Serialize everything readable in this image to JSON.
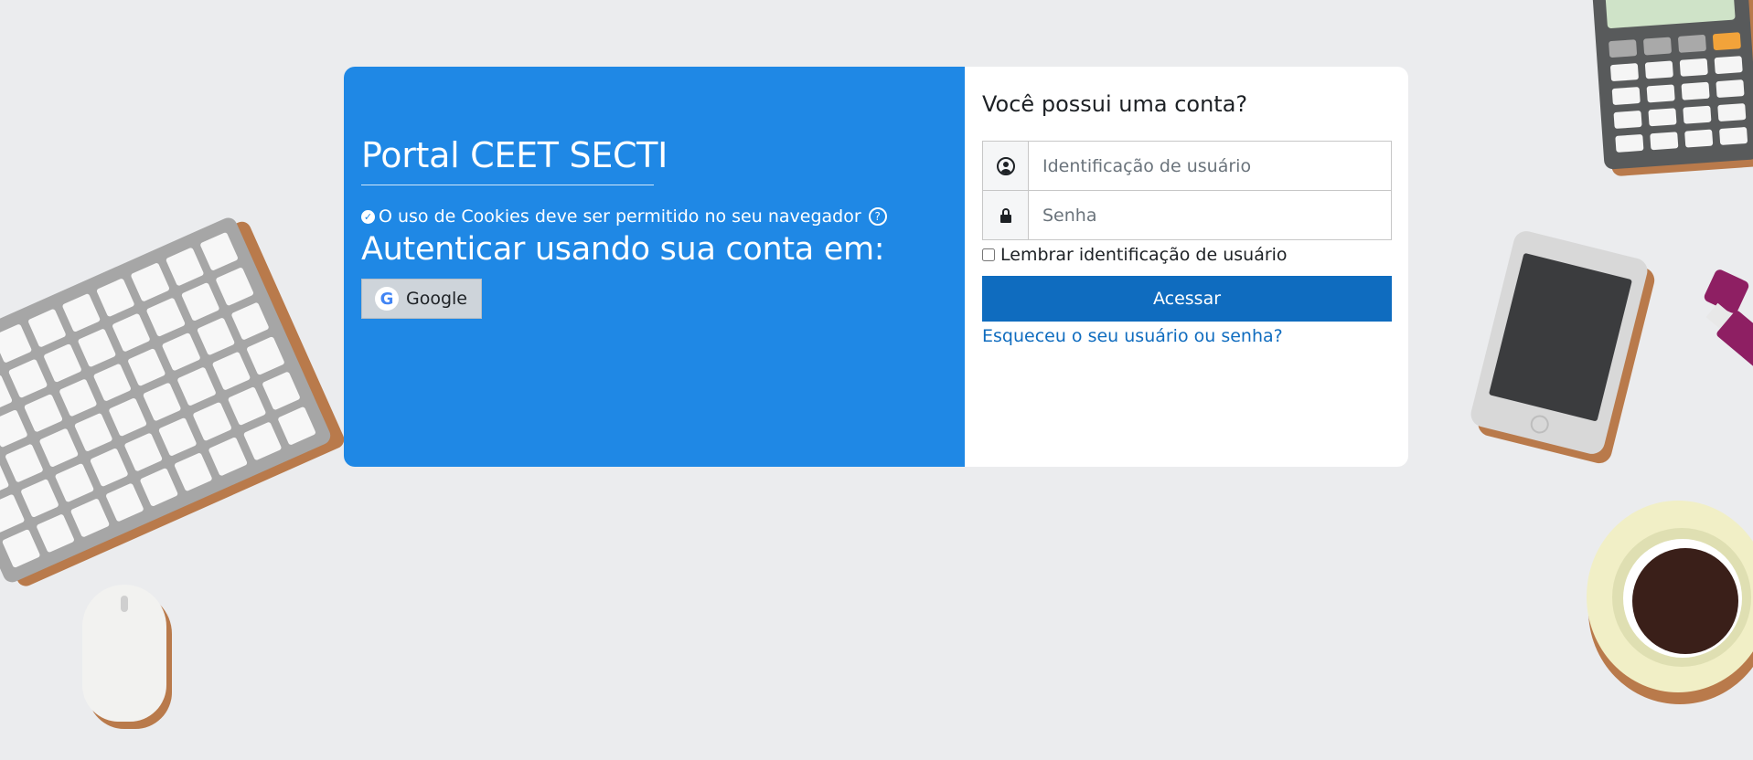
{
  "colors": {
    "background": "#ebecee",
    "brand_panel": "#1f88e5",
    "primary_button": "#0f6cbf",
    "link": "#0f6cbf"
  },
  "brand": {
    "site_title": "Portal CEET SECTI",
    "cookies_notice": "O uso de Cookies deve ser permitido no seu navegador",
    "cookies_check_icon": "check-circle-icon",
    "cookies_help_icon": "question-circle-icon",
    "identity_providers_heading": "Autenticar usando sua conta em:",
    "identity_providers": [
      {
        "label": "Google",
        "icon": "google-icon",
        "icon_glyph": "G"
      }
    ]
  },
  "login": {
    "heading": "Você possui uma conta?",
    "username_placeholder": "Identificação de usuário",
    "username_value": "",
    "username_icon": "user-circle-icon",
    "password_placeholder": "Senha",
    "password_value": "",
    "password_icon": "lock-icon",
    "remember_label": "Lembrar identificação de usuário",
    "remember_checked": false,
    "submit_label": "Acessar",
    "forgot_link": "Esqueceu o seu usuário ou senha?"
  },
  "decorations": [
    "keyboard-illustration",
    "mouse-illustration",
    "calculator-illustration",
    "phone-illustration",
    "usb-drive-illustration",
    "coffee-cup-illustration"
  ]
}
